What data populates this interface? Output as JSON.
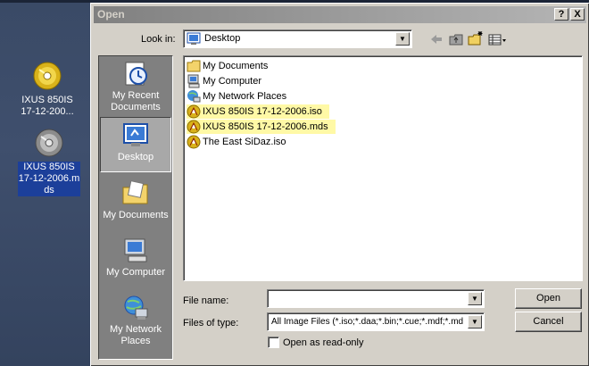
{
  "desktop": {
    "icons": [
      {
        "label_line1": "IXUS 850IS",
        "label_line2": "17-12-200...",
        "label_line3": ""
      },
      {
        "label_line1": "IXUS 850IS",
        "label_line2": "17-12-2006.m",
        "label_line3": "ds"
      }
    ]
  },
  "dialog": {
    "title": "Open",
    "help_label": "?",
    "close_label": "X",
    "look_in_label": "Look in:",
    "look_in_value": "Desktop",
    "places": [
      {
        "line1": "My Recent",
        "line2": "Documents"
      },
      {
        "line1": "Desktop",
        "line2": ""
      },
      {
        "line1": "My Documents",
        "line2": ""
      },
      {
        "line1": "My Computer",
        "line2": ""
      },
      {
        "line1": "My Network",
        "line2": "Places"
      }
    ],
    "files": [
      {
        "name": "My Documents",
        "icon": "folder-icon"
      },
      {
        "name": "My Computer",
        "icon": "computer-icon"
      },
      {
        "name": "My Network Places",
        "icon": "network-icon"
      },
      {
        "name": "IXUS 850IS 17-12-2006.iso",
        "icon": "image-file-icon"
      },
      {
        "name": "IXUS 850IS 17-12-2006.mds",
        "icon": "image-file-icon"
      },
      {
        "name": "The East SiDaz.iso",
        "icon": "image-file-icon"
      }
    ],
    "file_name_label": "File name:",
    "file_name_value": "",
    "files_of_type_label": "Files of type:",
    "files_of_type_value": "All Image Files (*.iso;*.daa;*.bin;*.cue;*.mdf;*.md",
    "read_only_label": "Open as read-only",
    "open_label": "Open",
    "cancel_label": "Cancel"
  },
  "colors": {
    "highlight": "#fff9a6",
    "selection": "#1c3f9a",
    "titlebar": "#808080"
  }
}
